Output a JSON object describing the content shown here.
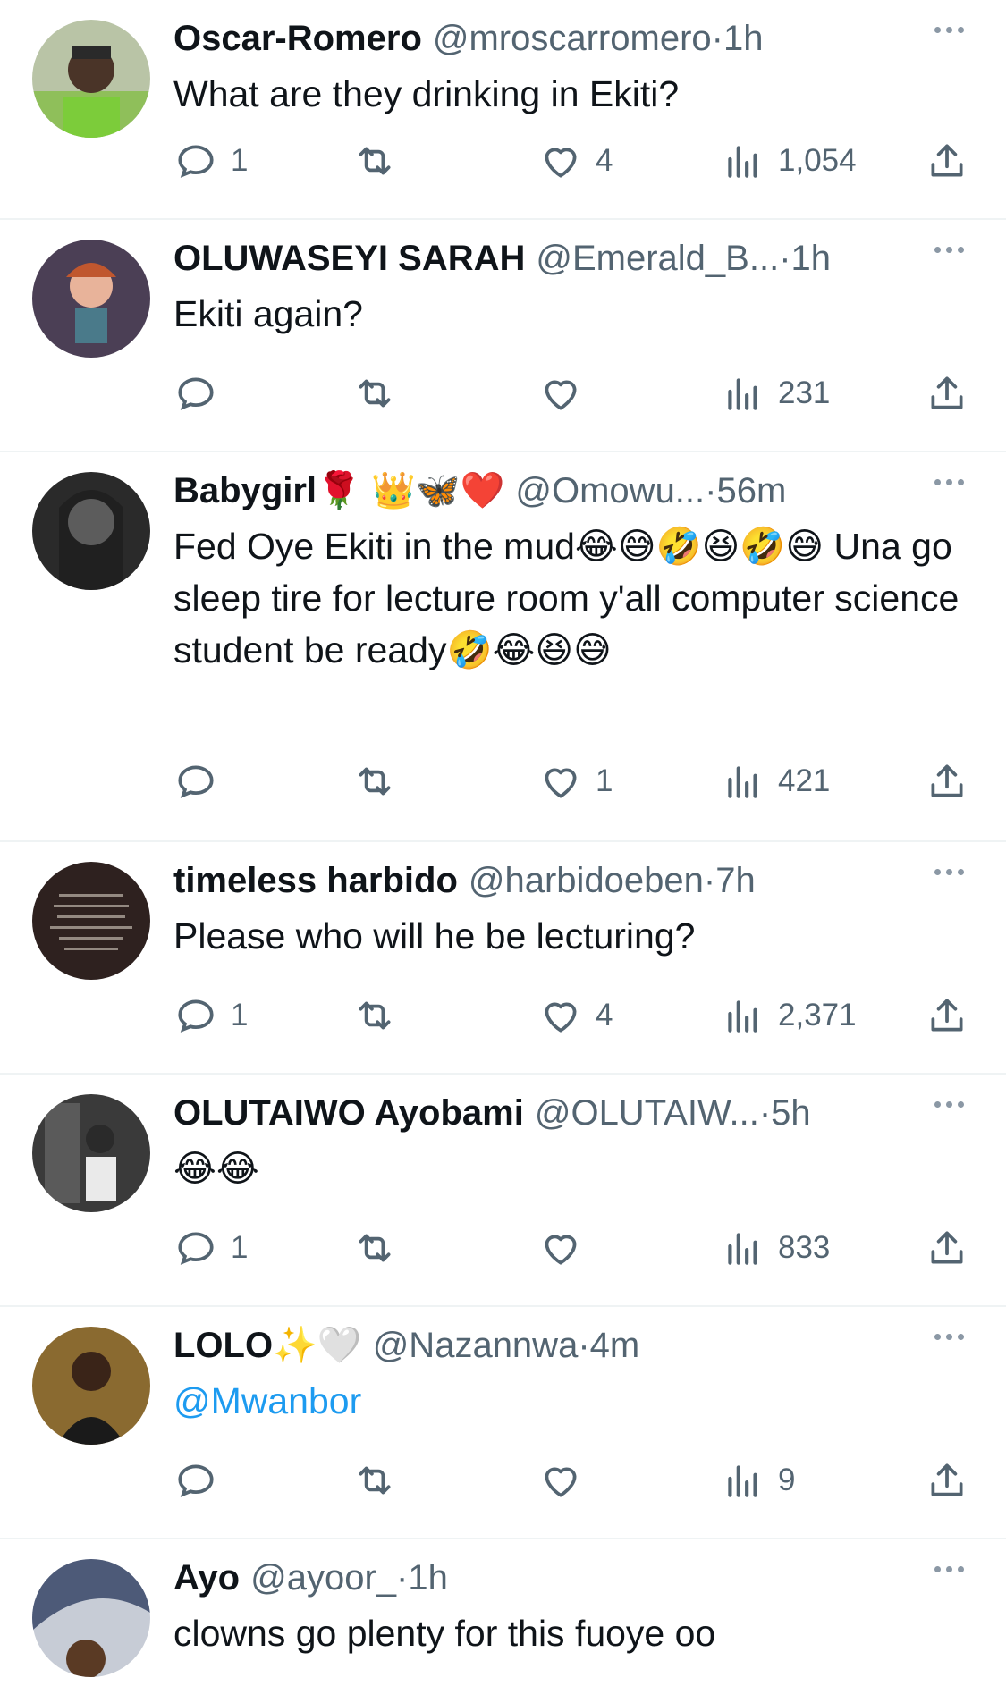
{
  "replies": [
    {
      "name": "Oscar-Romero",
      "name_emoji": "",
      "handle": "@mroscarromero",
      "dot": "·",
      "time": "1h",
      "text": "What are they drinking in Ekiti?",
      "replies": "1",
      "retweets": "",
      "likes": "4",
      "views": "1,054",
      "avatar_color": "#8fb36a"
    },
    {
      "name": "OLUWASEYI SARAH",
      "name_emoji": "",
      "handle": "@Emerald_B...",
      "dot": "·",
      "time": "1h",
      "text": "Ekiti again?",
      "replies": "",
      "retweets": "",
      "likes": "",
      "views": "231",
      "avatar_color": "#5a4a5e"
    },
    {
      "name": "Babygirl",
      "name_emoji": "🌹 👑🦋❤️",
      "handle": "@Omowu...",
      "dot": "·",
      "time": "56m",
      "text": "Fed Oye Ekiti in the mud😂😅🤣😆🤣😅 Una go sleep tire for lecture room y'all computer science student be ready🤣😂😆😅",
      "replies": "",
      "retweets": "",
      "likes": "1",
      "views": "421",
      "avatar_color": "#6a6a6a"
    },
    {
      "name": "timeless harbido",
      "name_emoji": "",
      "handle": "@harbidoeben",
      "dot": "·",
      "time": "7h",
      "text": "Please who will he be lecturing?",
      "replies": "1",
      "retweets": "",
      "likes": "4",
      "views": "2,371",
      "avatar_color": "#3a2a28"
    },
    {
      "name": "OLUTAIWO Ayobami",
      "name_emoji": "",
      "handle": "@OLUTAIW...",
      "dot": "·",
      "time": "5h",
      "text": "😂😂",
      "replies": "1",
      "retweets": "",
      "likes": "",
      "views": "833",
      "avatar_color": "#7a7a7a"
    },
    {
      "name": "LOLO",
      "name_emoji": "✨🤍",
      "handle": "@Nazannwa",
      "dot": "·",
      "time": "4m",
      "text": "@Mwanbor",
      "replies": "",
      "retweets": "",
      "likes": "",
      "views": "9",
      "avatar_color": "#8a6a30"
    },
    {
      "name": "Ayo",
      "name_emoji": "",
      "handle": "@ayoor_",
      "dot": "·",
      "time": "1h",
      "text": "clowns go plenty for this fuoye oo",
      "replies": "",
      "retweets": "",
      "likes": "",
      "views": "",
      "avatar_color": "#5a6a8a"
    }
  ],
  "icons": {
    "reply": "reply-icon",
    "retweet": "retweet-icon",
    "like": "heart-icon",
    "views": "views-icon",
    "share": "share-icon",
    "more": "more-icon"
  },
  "colors": {
    "text": "#0f1419",
    "muted": "#536471",
    "link": "#1d9bf0",
    "divider": "#eff3f4"
  }
}
